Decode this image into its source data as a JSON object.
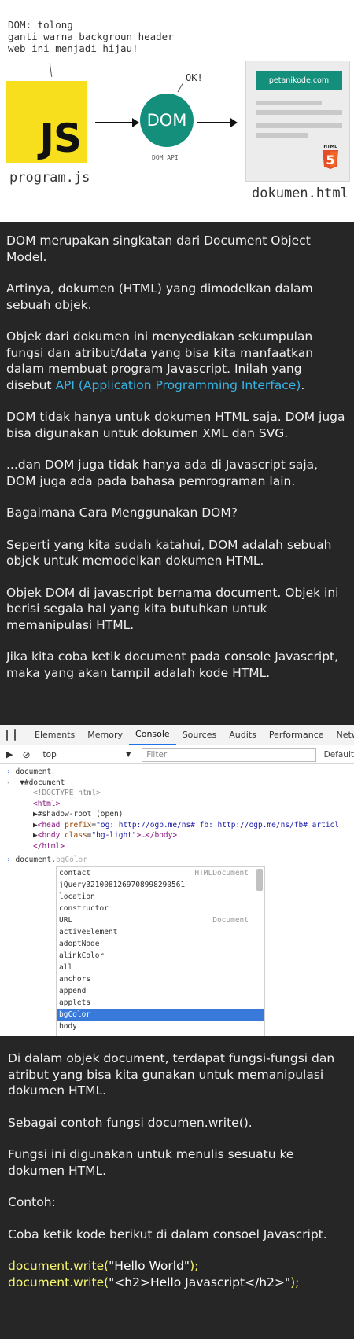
{
  "diagram": {
    "speech": "DOM: tolong\nganti warna backgroun header\nweb ini menjadi hijau!",
    "js_logo": "JS",
    "js_caption": "program.js",
    "dom_label": "DOM",
    "ok_text": "OK!",
    "dom_api": "DOM API",
    "site_label": "petanikode.com",
    "html5_badge": "HTML",
    "doc_caption": "dokumen.html",
    "colors": {
      "js_yellow": "#f7df1e",
      "teal": "#148f7c",
      "html5_orange": "#e44d26"
    }
  },
  "intro": {
    "p1": "DOM merupakan singkatan dari Document Object Model.",
    "p2": "Artinya, dokumen (HTML) yang dimodelkan dalam sebuah objek.",
    "p3_before": "Objek dari dokumen ini menyediakan sekumpulan fungsi dan atribut/data yang bisa kita manfaatkan dalam membuat program Javascript. Inilah yang disebut ",
    "p3_link": "API (Application Programming Interface)",
    "p3_after": ".",
    "p4": "DOM tidak hanya untuk dokumen HTML saja. DOM juga bisa digunakan untuk dokumen XML dan SVG.",
    "p5": "...dan DOM juga tidak hanya ada di Javascript saja, DOM juga ada pada bahasa pemrograman lain.",
    "p6": "Bagaimana Cara Menggunakan DOM?",
    "p7": "Seperti yang kita sudah katahui, DOM adalah sebuah objek untuk memodelkan dokumen HTML.",
    "p8": "Objek DOM di javascript bernama document. Objek ini berisi segala hal yang kita butuhkan untuk memanipulasi HTML.",
    "p9": "Jika kita coba ketik document pada console Javascript, maka yang akan tampil adalah kode HTML."
  },
  "devtools": {
    "tabs": [
      "Elements",
      "Memory",
      "Console",
      "Sources",
      "Audits",
      "Performance",
      "Netw"
    ],
    "active_tab": "Console",
    "context": "top",
    "filter_placeholder": "Filter",
    "levels": "Default",
    "console": {
      "cmd1": "document",
      "doc_node": "#document",
      "doctype": "<!DOCTYPE html>",
      "html_open": "<html>",
      "shadow_root": "#shadow-root (open)",
      "head_tag": "<head ",
      "head_attr_name": "prefix",
      "head_attr_value": "\"og: http://ogp.me/ns# fb: http://ogp.me/ns/fb# articl",
      "body_tag": "<body ",
      "body_attr_name": "class",
      "body_attr_value": "\"bg-light\"",
      "body_rest": ">…</body>",
      "html_close": "</html>",
      "cmd2_typed": "document.",
      "cmd2_ghost": "bgColor"
    },
    "autocomplete": [
      {
        "label": "contact",
        "hint": "HTMLDocument"
      },
      {
        "label": "jQuery3210081269708998290561",
        "hint": ""
      },
      {
        "label": "location",
        "hint": ""
      },
      {
        "label": "constructor",
        "hint": ""
      },
      {
        "label": "URL",
        "hint": "Document"
      },
      {
        "label": "activeElement",
        "hint": ""
      },
      {
        "label": "adoptNode",
        "hint": ""
      },
      {
        "label": "alinkColor",
        "hint": ""
      },
      {
        "label": "all",
        "hint": ""
      },
      {
        "label": "anchors",
        "hint": ""
      },
      {
        "label": "append",
        "hint": ""
      },
      {
        "label": "applets",
        "hint": ""
      },
      {
        "label": "bgColor",
        "hint": ""
      },
      {
        "label": "body",
        "hint": ""
      }
    ],
    "autocomplete_selected": 12
  },
  "outro": {
    "p1": "Di dalam objek document, terdapat fungsi-fungsi dan atribut yang bisa kita gunakan untuk memanipulasi dokumen HTML.",
    "p2": "Sebagai contoh fungsi documen.write().",
    "p3": "Fungsi ini digunakan untuk menulis sesuatu ke dokumen HTML.",
    "p4": "Contoh:",
    "p5": "Coba ketik kode berikut di dalam consoel Javascript.",
    "code1_a": "document.write(",
    "code1_s": "\"Hello World\"",
    "code1_b": ");",
    "code2_a": "document.write(",
    "code2_s": "\"<h2>Hello Javascript</h2>\"",
    "code2_b": ");"
  }
}
